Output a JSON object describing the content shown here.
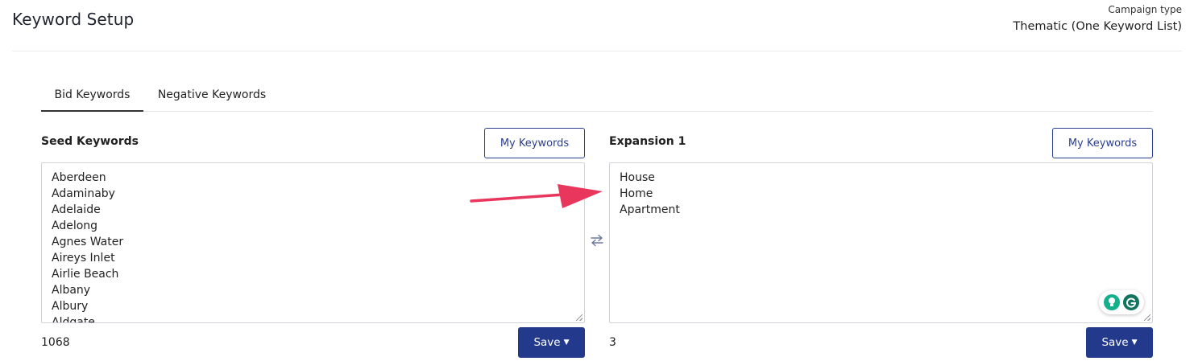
{
  "header": {
    "title": "Keyword Setup",
    "campaign_type_label": "Campaign type",
    "campaign_type_value": "Thematic (One Keyword List)"
  },
  "tabs": [
    {
      "label": "Bid Keywords",
      "active": true
    },
    {
      "label": "Negative Keywords",
      "active": false
    }
  ],
  "seed_panel": {
    "title": "Seed Keywords",
    "my_keywords_label": "My Keywords",
    "keywords": [
      "Aberdeen",
      "Adaminaby",
      "Adelaide",
      "Adelong",
      "Agnes Water",
      "Aireys Inlet",
      "Airlie Beach",
      "Albany",
      "Albury",
      "Aldgate"
    ],
    "count": "1068",
    "save_label": "Save"
  },
  "expansion_panel": {
    "title": "Expansion 1",
    "my_keywords_label": "My Keywords",
    "keywords": [
      "House",
      "Home",
      "Apartment"
    ],
    "count": "3",
    "save_label": "Save"
  },
  "icons": {
    "swap": "swap-arrows-icon",
    "caret": "caret-down-icon",
    "grammarly_bulb": "lightbulb-icon",
    "grammarly_logo": "grammarly-icon"
  },
  "colors": {
    "primary": "#233a8c",
    "annotation_arrow": "#e8365d",
    "grammarly_green": "#14b08a"
  }
}
